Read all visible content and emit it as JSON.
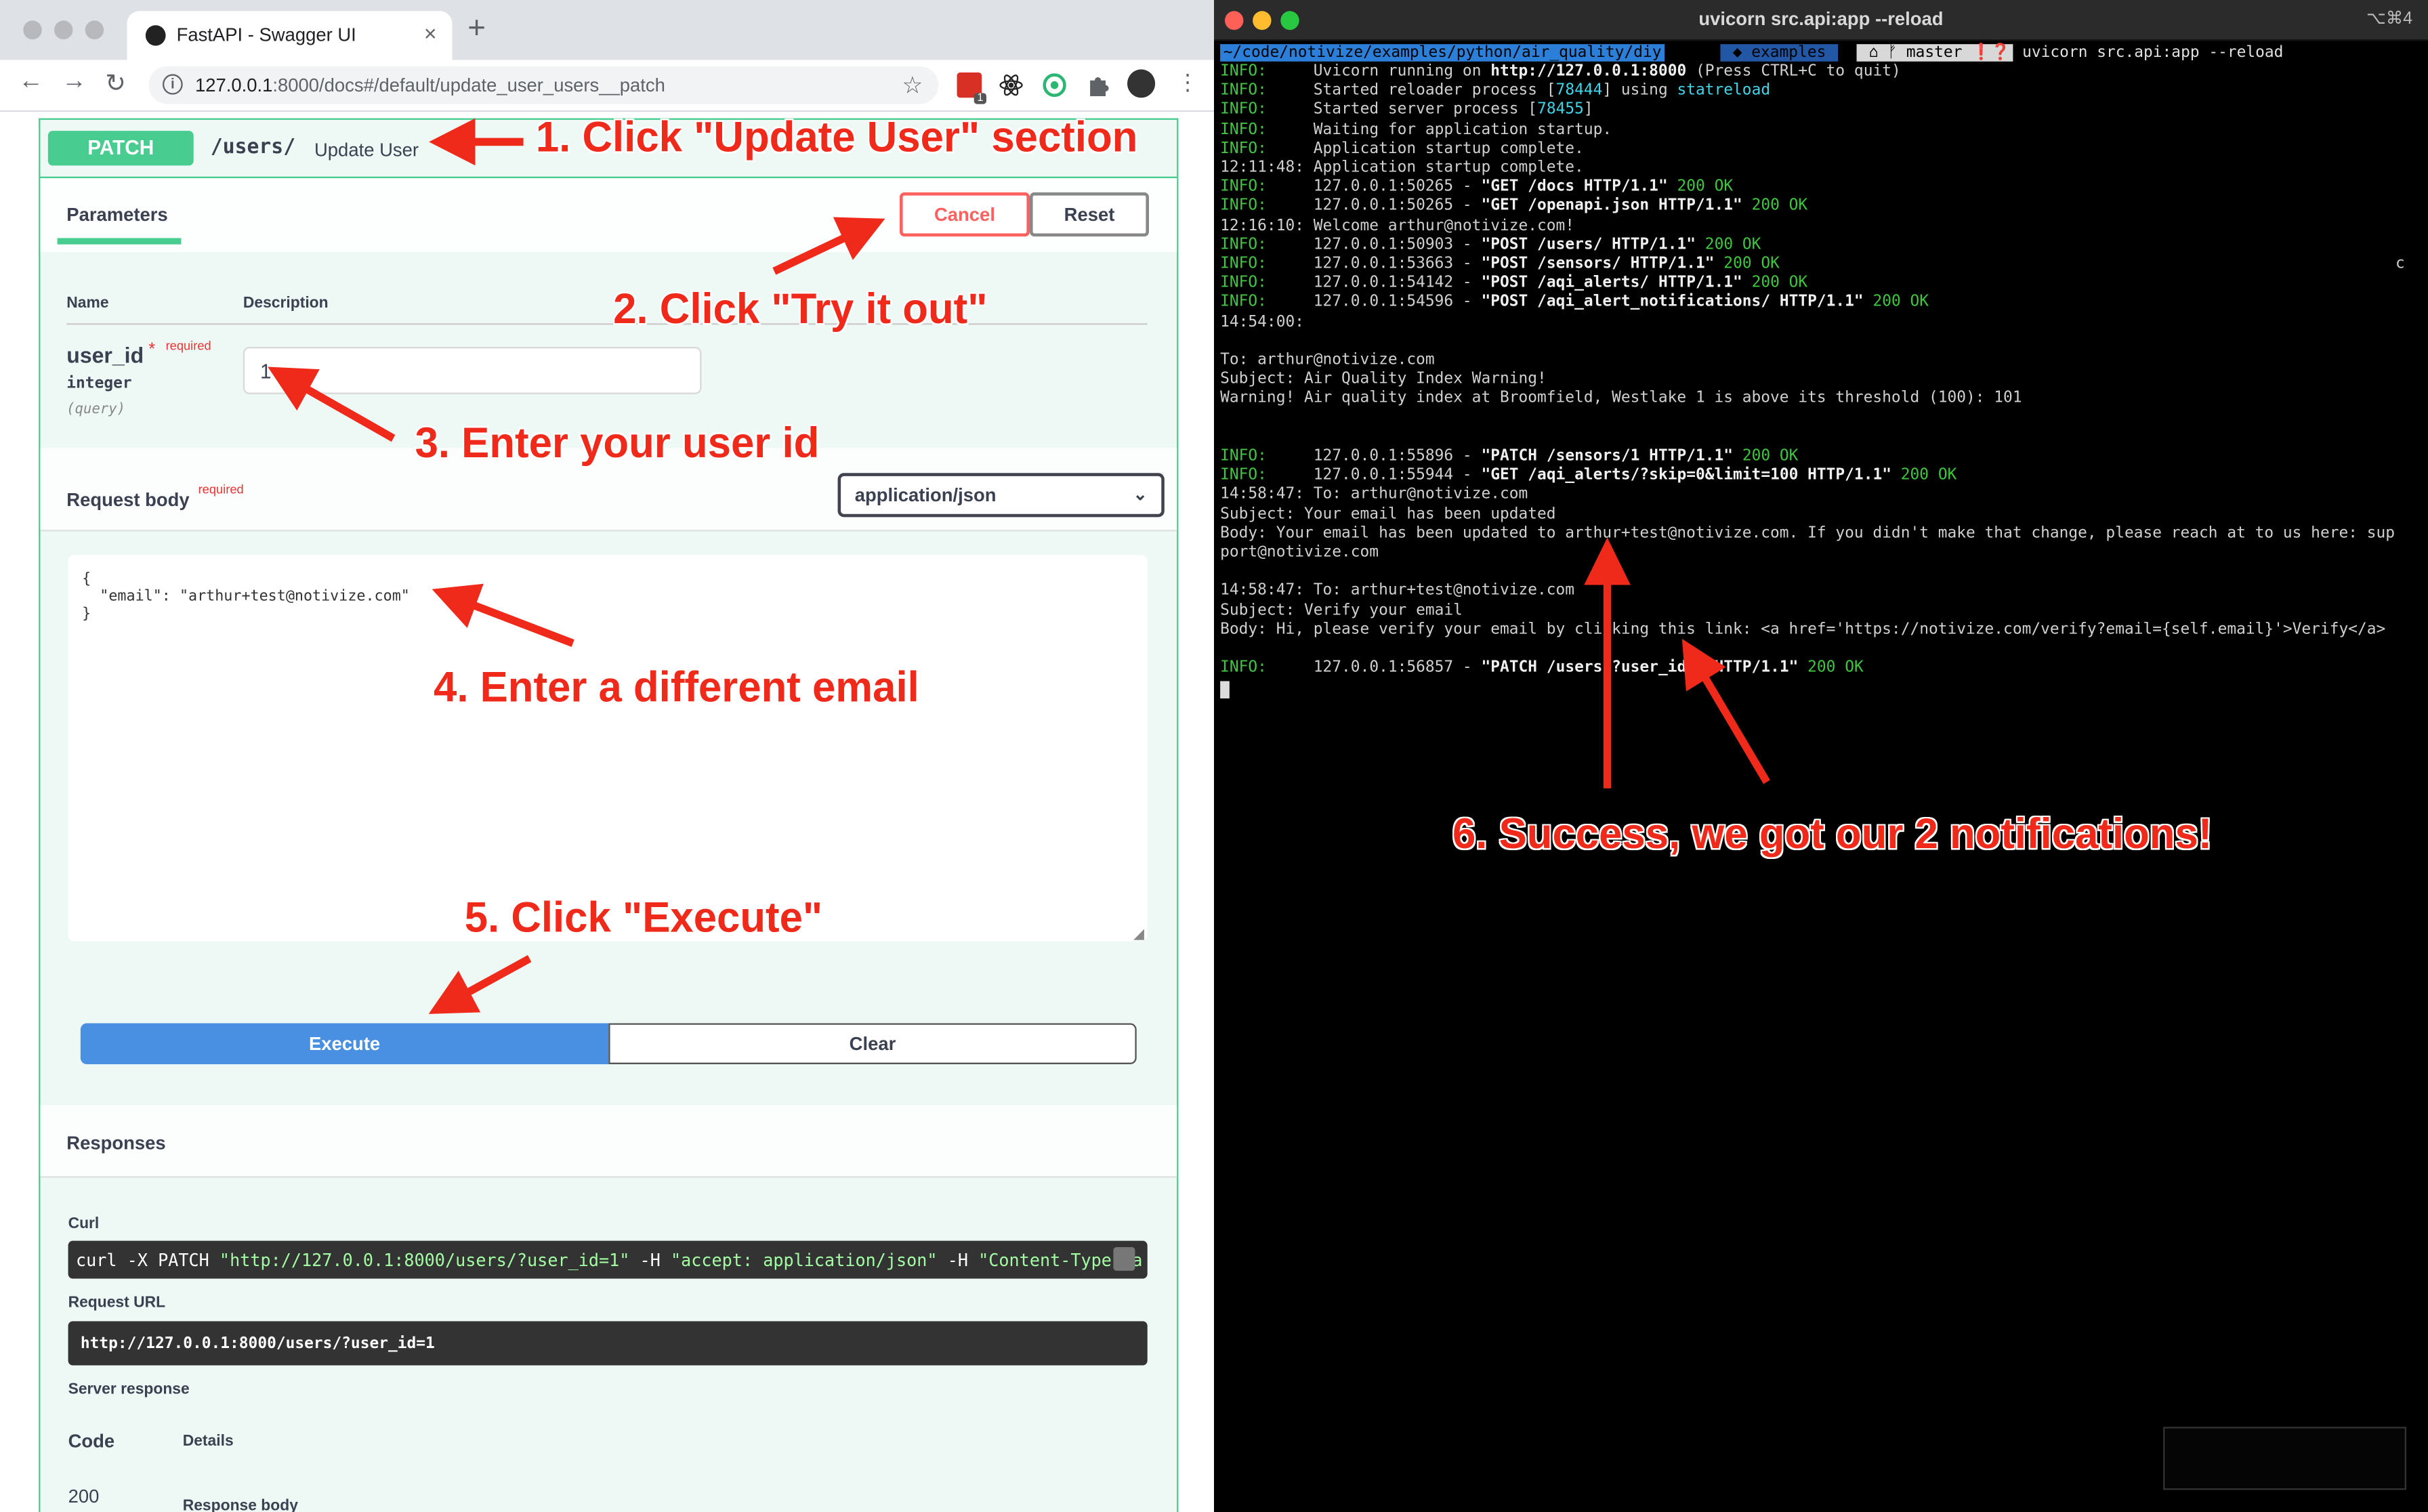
{
  "browser": {
    "tab_title": "FastAPI - Swagger UI",
    "tab_close": "×",
    "new_tab": "+",
    "nav": {
      "back": "←",
      "forward": "→",
      "reload": "↻"
    },
    "url_host": "127.0.0.1",
    "url_rest": ":8000/docs#/default/update_user_users__patch",
    "ext_badge": "1",
    "icons": [
      "info-icon",
      "star-icon",
      "calendar-extension-icon",
      "react-extension-icon",
      "circle-extension-icon",
      "puzzle-icon",
      "avatar",
      "menu-icon"
    ]
  },
  "swagger": {
    "method": "PATCH",
    "path": "/users/",
    "summary": "Update User",
    "parameters_title": "Parameters",
    "cancel_label": "Cancel",
    "reset_label": "Reset",
    "col_name": "Name",
    "col_description": "Description",
    "param": {
      "name": "user_id",
      "required_star": "*",
      "required_label": "required",
      "type": "integer",
      "in": "(query)",
      "value": "1"
    },
    "request_body_title": "Request body",
    "request_body_required": "required",
    "content_type": "application/json",
    "body_lines": [
      "{",
      "  \"email\": \"arthur+test@notivize.com\"",
      "}"
    ],
    "execute_label": "Execute",
    "clear_label": "Clear",
    "responses_title": "Responses",
    "curl_label": "Curl",
    "curl_cmd": "curl -X PATCH ",
    "curl_url": "\"http://127.0.0.1:8000/users/?user_id=1\"",
    "curl_h1": " -H ",
    "curl_accept": " \"accept: application/json\"",
    "curl_h2": " -H ",
    "curl_ct": " \"Content-Type: a",
    "request_url_label": "Request URL",
    "request_url": "http://127.0.0.1:8000/users/?user_id=1",
    "server_response_label": "Server response",
    "code_header": "Code",
    "details_header": "Details",
    "code_value": "200",
    "response_body_label": "Response body"
  },
  "terminal": {
    "title": "uvicorn src.api:app --reload",
    "shortcut": "⌥⌘4",
    "prompt_path": "~/code/notivize/examples/python/air_quality/diy",
    "prompt_branch": " ◆ examples ",
    "prompt_git": " ⌂ ᚠ master ❗❓",
    "prompt_cmd": "uvicorn src.api:app --reload",
    "stray_char": "c",
    "lines": [
      [
        {
          "t": "INFO:",
          "c": "g"
        },
        {
          "t": "     Uvicorn running on "
        },
        {
          "t": "http://127.0.0.1:8000",
          "c": "b"
        },
        {
          "t": " (Press CTRL+C to quit)"
        }
      ],
      [
        {
          "t": "INFO:",
          "c": "g"
        },
        {
          "t": "     Started reloader process ["
        },
        {
          "t": "78444",
          "c": "c"
        },
        {
          "t": "] using "
        },
        {
          "t": "statreload",
          "c": "c"
        }
      ],
      [
        {
          "t": "INFO:",
          "c": "g"
        },
        {
          "t": "     Started server process ["
        },
        {
          "t": "78455",
          "c": "c"
        },
        {
          "t": "]"
        }
      ],
      [
        {
          "t": "INFO:",
          "c": "g"
        },
        {
          "t": "     Waiting for application startup."
        }
      ],
      [
        {
          "t": "INFO:",
          "c": "g"
        },
        {
          "t": "     Application startup complete."
        }
      ],
      [
        {
          "t": "12:11:48: Application startup complete."
        }
      ],
      [
        {
          "t": "INFO:",
          "c": "g"
        },
        {
          "t": "     127.0.0.1:50265 - "
        },
        {
          "t": "\"GET /docs HTTP/1.1\"",
          "c": "b"
        },
        {
          "t": " "
        },
        {
          "t": "200 OK",
          "c": "gok"
        }
      ],
      [
        {
          "t": "INFO:",
          "c": "g"
        },
        {
          "t": "     127.0.0.1:50265 - "
        },
        {
          "t": "\"GET /openapi.json HTTP/1.1\"",
          "c": "b"
        },
        {
          "t": " "
        },
        {
          "t": "200 OK",
          "c": "gok"
        }
      ],
      [
        {
          "t": "12:16:10: Welcome arthur@notivize.com!"
        }
      ],
      [
        {
          "t": "INFO:",
          "c": "g"
        },
        {
          "t": "     127.0.0.1:50903 - "
        },
        {
          "t": "\"POST /users/ HTTP/1.1\"",
          "c": "b"
        },
        {
          "t": " "
        },
        {
          "t": "200 OK",
          "c": "gok"
        }
      ],
      [
        {
          "t": "INFO:",
          "c": "g"
        },
        {
          "t": "     127.0.0.1:53663 - "
        },
        {
          "t": "\"POST /sensors/ HTTP/1.1\"",
          "c": "b"
        },
        {
          "t": " "
        },
        {
          "t": "200 OK",
          "c": "gok"
        }
      ],
      [
        {
          "t": "INFO:",
          "c": "g"
        },
        {
          "t": "     127.0.0.1:54142 - "
        },
        {
          "t": "\"POST /aqi_alerts/ HTTP/1.1\"",
          "c": "b"
        },
        {
          "t": " "
        },
        {
          "t": "200 OK",
          "c": "gok"
        }
      ],
      [
        {
          "t": "INFO:",
          "c": "g"
        },
        {
          "t": "     127.0.0.1:54596 - "
        },
        {
          "t": "\"POST /aqi_alert_notifications/ HTTP/1.1\"",
          "c": "b"
        },
        {
          "t": " "
        },
        {
          "t": "200 OK",
          "c": "gok"
        }
      ],
      [
        {
          "t": "14:54:00:"
        }
      ],
      [],
      [
        {
          "t": "To: arthur@notivize.com"
        }
      ],
      [
        {
          "t": "Subject: Air Quality Index Warning!"
        }
      ],
      [
        {
          "t": "Warning! Air quality index at Broomfield, Westlake 1 is above its threshold (100): 101"
        }
      ],
      [],
      [],
      [
        {
          "t": "INFO:",
          "c": "g"
        },
        {
          "t": "     127.0.0.1:55896 - "
        },
        {
          "t": "\"PATCH /sensors/1 HTTP/1.1\"",
          "c": "b"
        },
        {
          "t": " "
        },
        {
          "t": "200 OK",
          "c": "gok"
        }
      ],
      [
        {
          "t": "INFO:",
          "c": "g"
        },
        {
          "t": "     127.0.0.1:55944 - "
        },
        {
          "t": "\"GET /aqi_alerts/?skip=0&limit=100 HTTP/1.1\"",
          "c": "b"
        },
        {
          "t": " "
        },
        {
          "t": "200 OK",
          "c": "gok"
        }
      ],
      [
        {
          "t": "14:58:47: To: arthur@notivize.com"
        }
      ],
      [
        {
          "t": "Subject: Your email has been updated"
        }
      ],
      [
        {
          "t": "Body: Your email has been updated to arthur+test@notivize.com. If you didn't make that change, please reach at to us here: sup"
        }
      ],
      [
        {
          "t": "port@notivize.com"
        }
      ],
      [],
      [
        {
          "t": "14:58:47: To: arthur+test@notivize.com"
        }
      ],
      [
        {
          "t": "Subject: Verify your email"
        }
      ],
      [
        {
          "t": "Body: Hi, please verify your email by clicking this link: <a href='https://notivize.com/verify?email={self.email}'>Verify</a>"
        }
      ],
      [],
      [
        {
          "t": "INFO:",
          "c": "g"
        },
        {
          "t": "     127.0.0.1:56857 - "
        },
        {
          "t": "\"PATCH /users/?user_id=1 HTTP/1.1\"",
          "c": "b"
        },
        {
          "t": " "
        },
        {
          "t": "200 OK",
          "c": "gok"
        }
      ]
    ]
  },
  "annotations": {
    "step1": "1. Click \"Update User\" section",
    "step2": "2. Click \"Try it out\"",
    "step3": "3. Enter your user id",
    "step4": "4. Enter a different email",
    "step5": "5. Click \"Execute\"",
    "step6": "6. Success, we got our 2 notifications!"
  },
  "colors": {
    "patch_green": "#49cc90",
    "execute_blue": "#4990e2",
    "annotation_red": "#f02a1a",
    "terminal_info_green": "#43c443"
  }
}
